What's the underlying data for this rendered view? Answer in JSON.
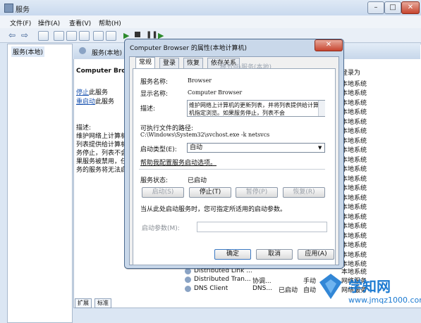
{
  "window": {
    "title": "服务",
    "min": "–",
    "max": "□",
    "close": "✕"
  },
  "menu": [
    "文件(F)",
    "操作(A)",
    "查看(V)",
    "帮助(H)"
  ],
  "tree": {
    "root": "服务(本地)"
  },
  "content": {
    "header": "服务(本地)",
    "selected_name": "Computer Browser",
    "stop_link": "停止",
    "stop_suffix": "此服务",
    "restart_link": "重启动",
    "restart_suffix": "此服务",
    "desc_label": "描述:",
    "desc_lines": [
      "维护网络上计算机",
      "列表提供给计算机",
      "务停止，列表不会",
      "果服务被禁用，任",
      "务的服务将无法启"
    ],
    "login_col_header": "登录为",
    "login_col_values": [
      "本地系统",
      "本地系统",
      "本地系统",
      "本地系统",
      "本地系统",
      "本地系统",
      "本地系统",
      "本地系统",
      "本地系统",
      "本地系统",
      "本地系统",
      "本地系统",
      "本地系统",
      "本地系统",
      "本地系统",
      "本地系统",
      "本地系统",
      "本地系统",
      "本地系统",
      "本地系统",
      "本地系统"
    ],
    "rows": [
      {
        "name": "Distributed Link ...",
        "desc": "",
        "status": "",
        "startup": "",
        "login": ""
      },
      {
        "name": "Distributed Tran...",
        "desc": "协调...",
        "status": "",
        "startup": "手动",
        "login": "网络服务"
      },
      {
        "name": "DNS Client",
        "desc": "DNS...",
        "status": "已启动",
        "startup": "自动",
        "login": "网络服务"
      }
    ],
    "tabs": [
      "扩展",
      "标准"
    ]
  },
  "dialog": {
    "title": "Computer Browser 的属性(本地计算机)",
    "close": "✕",
    "tabs": [
      "常规",
      "登录",
      "恢复",
      "依存关系"
    ],
    "ghost_text": "根节点\\服务(本地)",
    "service_name_label": "服务名称:",
    "service_name": "Browser",
    "display_name_label": "显示名称:",
    "display_name": "Computer Browser",
    "description_label": "描述:",
    "description": "维护网络上计算机的更新列表，并将列表提供给计算机指定浏览。如果服务停止，列表不会",
    "path_label": "可执行文件的路径:",
    "path": "C:\\Windows\\System32\\svchost.exe -k netsvcs",
    "startup_label": "启动类型(E):",
    "startup_value": "自动",
    "help_link": "帮助我配置服务启动选项。",
    "status_label": "服务状态:",
    "status_value": "已启动",
    "buttons": {
      "start": "启动(S)",
      "stop": "停止(T)",
      "pause": "暂停(P)",
      "resume": "恢复(R)"
    },
    "hint": "当从此处启动服务时，您可指定所适用的启动参数。",
    "param_label": "启动参数(M):",
    "ok": "确定",
    "cancel": "取消",
    "apply": "应用(A)"
  },
  "watermark": {
    "brand": "学知网",
    "url": "www.jmqz1000.com"
  }
}
